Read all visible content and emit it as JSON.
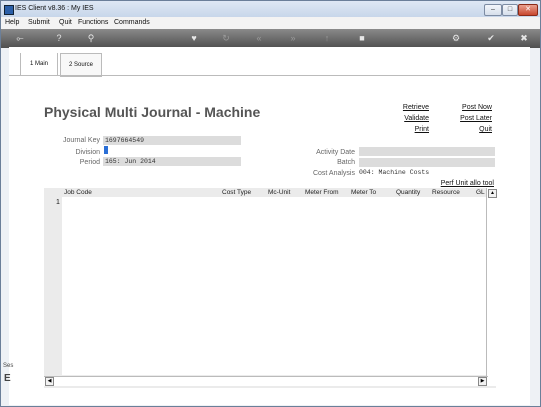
{
  "window": {
    "title": "IES Client v8.36 : My IES"
  },
  "window_buttons": {
    "minimize": "–",
    "restore": "□",
    "close": "✕"
  },
  "menu": {
    "items": [
      "Help",
      "Submit",
      "Quit",
      "Functions",
      "Commands"
    ]
  },
  "tabs": [
    {
      "label": "1 Main"
    },
    {
      "label": "2 Source"
    }
  ],
  "page": {
    "title": "Physical Multi Journal - Machine"
  },
  "actions": {
    "retrieve": "Retrieve",
    "validate": "Validate",
    "print": "Print",
    "post_now": "Post Now",
    "post_later": "Post Later",
    "quit": "Quit"
  },
  "form": {
    "journal_key": {
      "label": "Journal Key",
      "value": "1697664549"
    },
    "division": {
      "label": "Division",
      "value": ""
    },
    "period": {
      "label": "Period",
      "value": "165: Jun 2014"
    },
    "activity_date": {
      "label": "Activity Date",
      "value": ""
    },
    "batch": {
      "label": "Batch",
      "value": ""
    },
    "cost_analysis": {
      "label": "Cost Analysis",
      "value": "004: Machine Costs"
    },
    "perf_unit_link": "Perf Unit allo tool"
  },
  "grid": {
    "columns": [
      "Job Code",
      "Cost Type",
      "Mc-Unit",
      "Meter From",
      "Meter To",
      "Quantity",
      "Resource",
      "GL"
    ],
    "rows": [
      "1"
    ]
  },
  "side_fragments": {
    "a": "Ses",
    "b": "E"
  }
}
